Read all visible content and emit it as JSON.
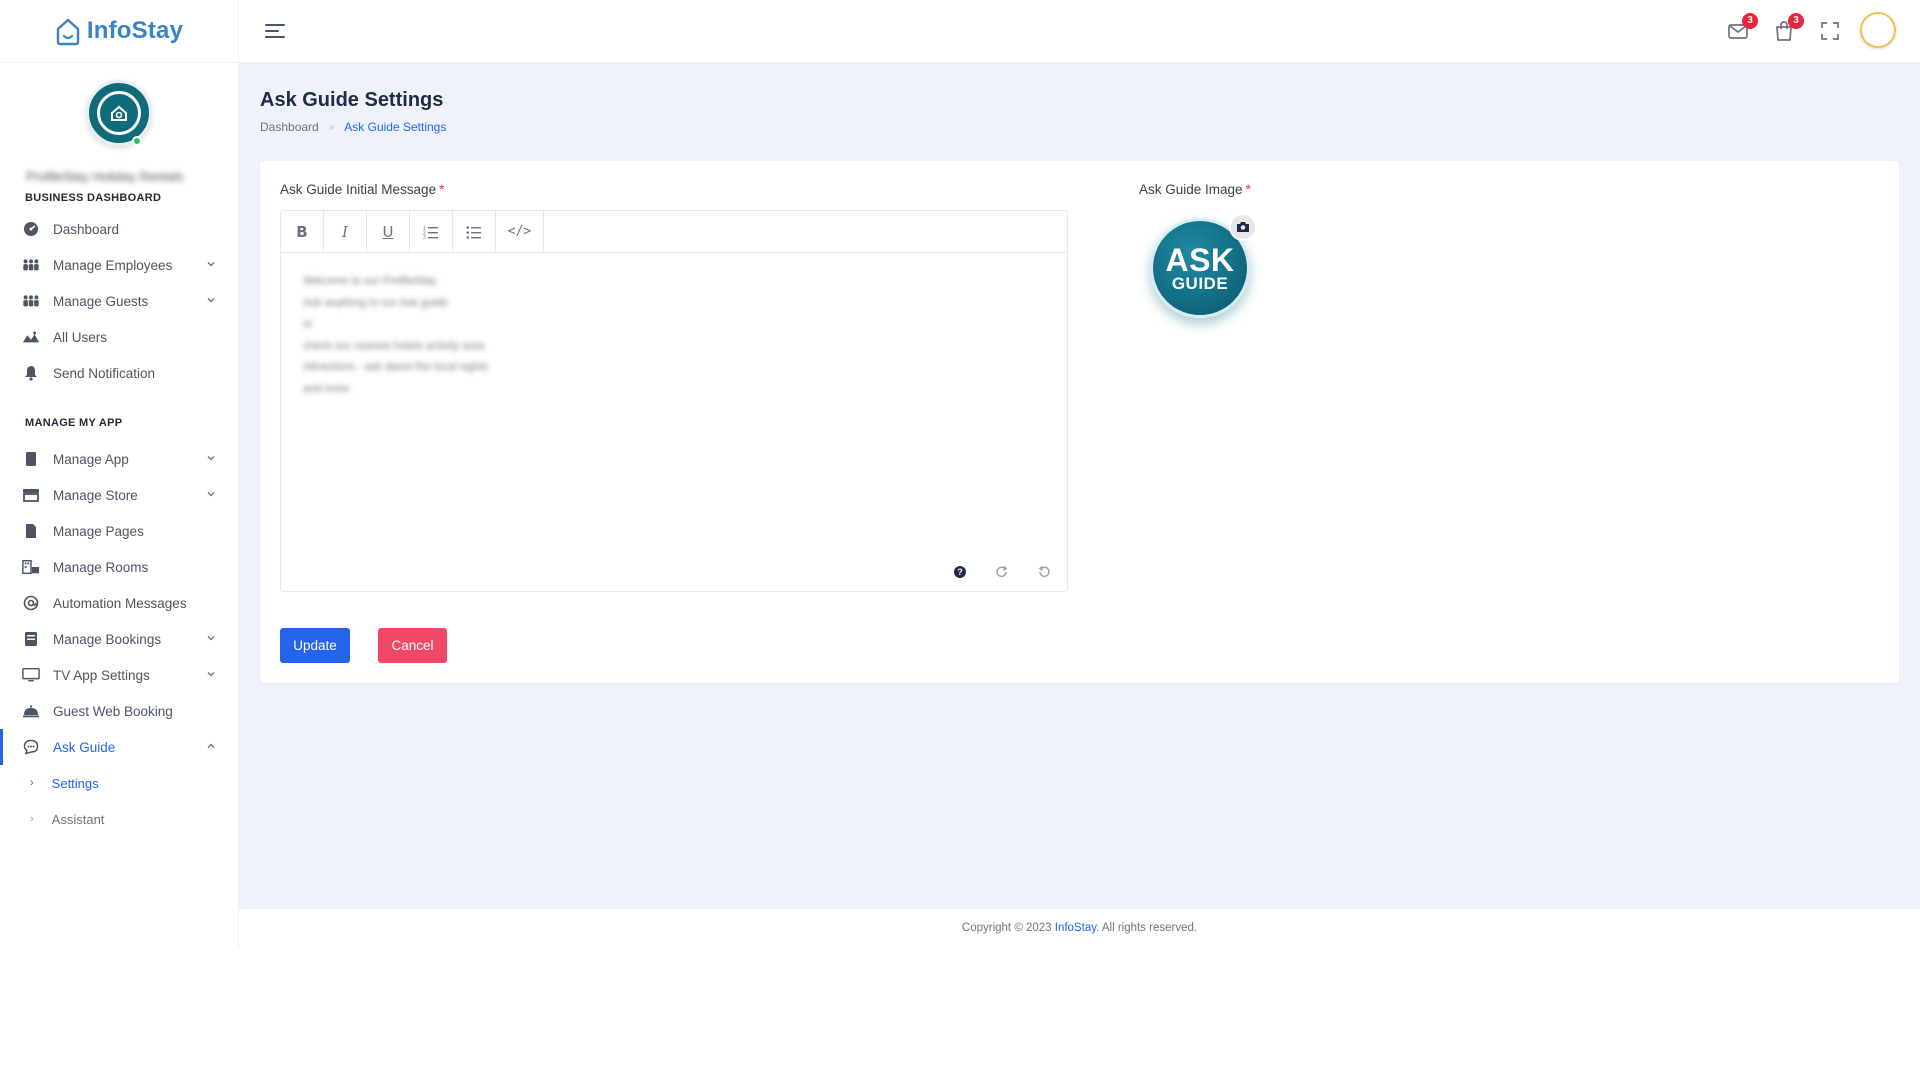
{
  "app": {
    "name": "InfoStay"
  },
  "sidebar": {
    "profile_name": "ProfileStay Holiday Rentals",
    "sections": [
      {
        "title": "BUSINESS DASHBOARD"
      },
      {
        "title": "MANAGE MY APP"
      }
    ],
    "business_items": [
      {
        "label": "Dashboard",
        "icon": "dashboard-icon",
        "chevron": false
      },
      {
        "label": "Manage Employees",
        "icon": "employees-icon",
        "chevron": true
      },
      {
        "label": "Manage Guests",
        "icon": "guests-icon",
        "chevron": true
      },
      {
        "label": "All Users",
        "icon": "users-icon",
        "chevron": false
      },
      {
        "label": "Send Notification",
        "icon": "bell-icon",
        "chevron": false
      }
    ],
    "app_items": [
      {
        "label": "Manage App",
        "icon": "app-icon",
        "chevron": true
      },
      {
        "label": "Manage Store",
        "icon": "store-icon",
        "chevron": true
      },
      {
        "label": "Manage Pages",
        "icon": "pages-icon",
        "chevron": false
      },
      {
        "label": "Manage Rooms",
        "icon": "rooms-icon",
        "chevron": false
      },
      {
        "label": "Automation Messages",
        "icon": "at-icon",
        "chevron": false
      },
      {
        "label": "Manage Bookings",
        "icon": "bookings-icon",
        "chevron": true
      },
      {
        "label": "TV App Settings",
        "icon": "tv-icon",
        "chevron": true
      },
      {
        "label": "Guest Web Booking",
        "icon": "booking-icon",
        "chevron": false
      },
      {
        "label": "Ask Guide",
        "icon": "chat-icon",
        "chevron": true,
        "active": true
      }
    ],
    "ask_guide_sub": [
      {
        "label": "Settings",
        "active": true
      },
      {
        "label": "Assistant",
        "active": false
      }
    ]
  },
  "header": {
    "mail_badge": "3",
    "cart_badge": "3"
  },
  "page": {
    "title": "Ask Guide Settings",
    "breadcrumb": {
      "home": "Dashboard",
      "separator": "»",
      "current": "Ask Guide Settings"
    }
  },
  "form": {
    "message_label": "Ask Guide Initial Message",
    "image_label": "Ask Guide Image",
    "required_mark": "*",
    "toolbar": {
      "bold": "B",
      "italic": "I",
      "underline": "U",
      "code": "</>"
    },
    "message_lines": [
      "Welcome to our ProfileStay",
      "Ask anything to our Ask guide",
      "or",
      "check our nearest hotels activity area",
      "Attractions - ask about the local sights",
      "and more"
    ],
    "guide_image_text": {
      "line1": "ASK",
      "line2": "GUIDE"
    },
    "update_label": "Update",
    "cancel_label": "Cancel"
  },
  "footer": {
    "prefix": "Copyright © 2023 ",
    "brand": "InfoStay",
    "suffix": ". All rights reserved."
  },
  "colors": {
    "accent": "#2563eb",
    "danger": "#f14868",
    "badge": "#ef233c",
    "guide_teal": "#116c82",
    "main_bg": "#eef2fa"
  }
}
